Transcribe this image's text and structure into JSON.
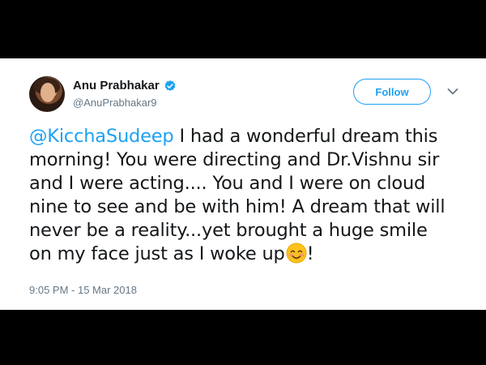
{
  "tweet": {
    "author": {
      "display_name": "Anu Prabhakar",
      "handle": "@AnuPrabhakar9",
      "verified_icon": "verified-badge-icon",
      "avatar_icon": "profile-photo"
    },
    "follow_label": "Follow",
    "menu_icon": "chevron-down-icon",
    "mention": "@KicchaSudeep",
    "body_text": " I had a wonderful dream this morning! You were directing and Dr.Vishnu sir and I were acting.... You and I were on cloud nine to see and be with him! A dream that will never be a reality...yet brought a huge smile on my face just as I woke up",
    "emoji": "smiling-face-with-smiling-eyes-icon",
    "trailing_text": "!",
    "timestamp": "9:05 PM - 15 Mar 2018"
  },
  "colors": {
    "accent": "#1da1f2",
    "text": "#14171a",
    "secondary_text": "#657786",
    "background": "#ffffff",
    "frame": "#000000"
  }
}
